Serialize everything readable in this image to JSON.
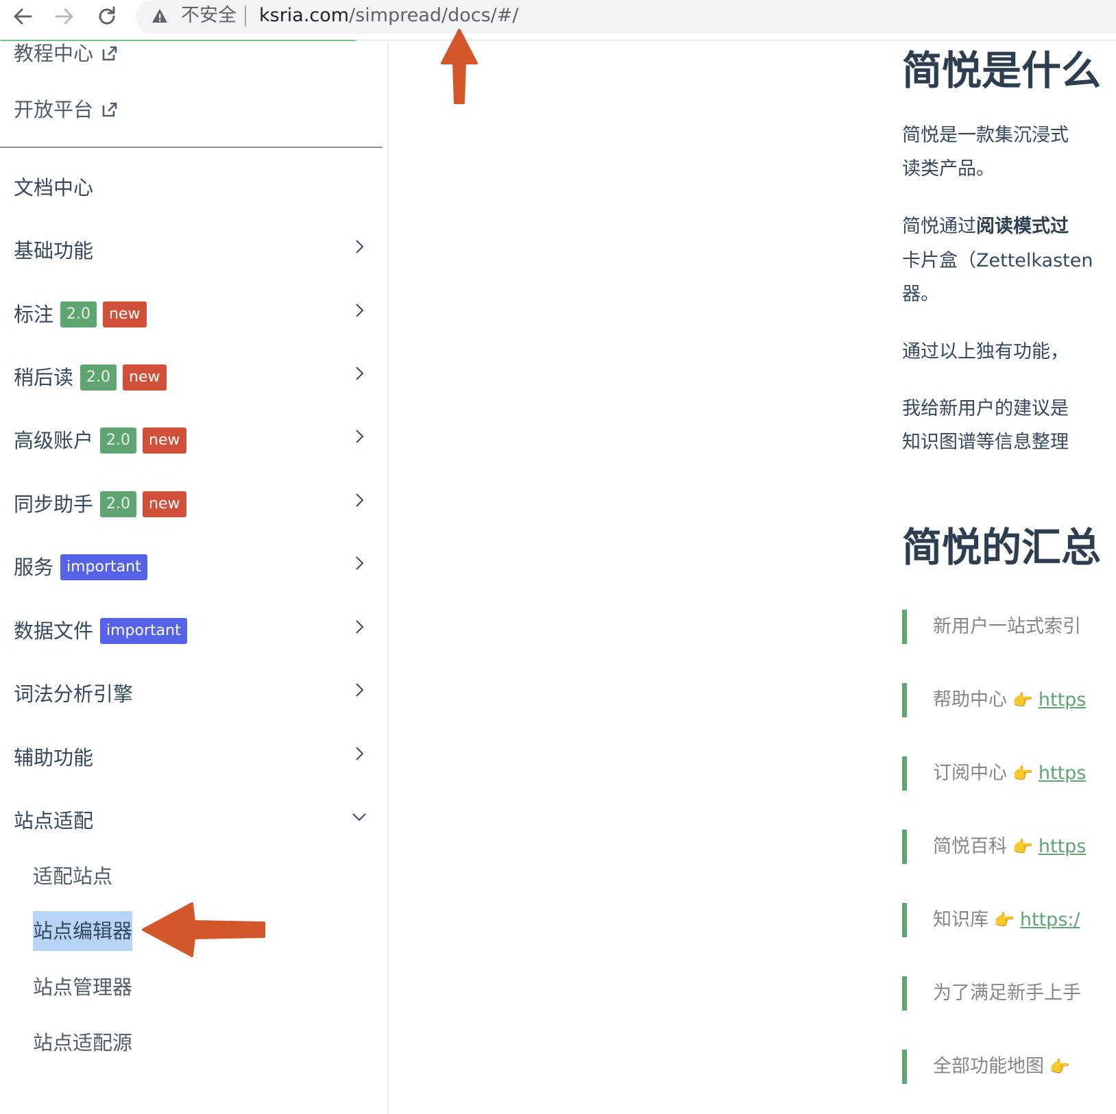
{
  "browser": {
    "security_label": "不安全",
    "url_host": "ksria.com",
    "url_path": "/simpread/docs/#/"
  },
  "sidebar": {
    "external_links": [
      {
        "label": "教程中心"
      },
      {
        "label": "开放平台"
      }
    ],
    "section_title": "文档中心",
    "items": [
      {
        "label": "基础功能",
        "badges": []
      },
      {
        "label": "标注",
        "badges": [
          {
            "text": "2.0",
            "color": "green"
          },
          {
            "text": "new",
            "color": "red"
          }
        ]
      },
      {
        "label": "稍后读",
        "badges": [
          {
            "text": "2.0",
            "color": "green"
          },
          {
            "text": "new",
            "color": "red"
          }
        ]
      },
      {
        "label": "高级账户",
        "badges": [
          {
            "text": "2.0",
            "color": "green"
          },
          {
            "text": "new",
            "color": "red"
          }
        ]
      },
      {
        "label": "同步助手",
        "badges": [
          {
            "text": "2.0",
            "color": "green"
          },
          {
            "text": "new",
            "color": "red"
          }
        ]
      },
      {
        "label": "服务",
        "badges": [
          {
            "text": "important",
            "color": "blue"
          }
        ]
      },
      {
        "label": "数据文件",
        "badges": [
          {
            "text": "important",
            "color": "blue"
          }
        ]
      },
      {
        "label": "词法分析引擎",
        "badges": []
      },
      {
        "label": "辅助功能",
        "badges": []
      },
      {
        "label": "站点适配",
        "badges": [],
        "expanded": true
      }
    ],
    "sub_items": [
      {
        "label": "适配站点"
      },
      {
        "label": "站点编辑器",
        "active": true
      },
      {
        "label": "站点管理器"
      },
      {
        "label": "站点适配源"
      }
    ]
  },
  "content": {
    "heading1": "简悦是什么",
    "p1_line1": "简悦是一款集沉浸式",
    "p1_line2": "读类产品。",
    "p2_prefix": "简悦通过",
    "p2_bold": "阅读模式过",
    "p2_line2": "卡片盒（Zettelkasten",
    "p2_line3": "器。",
    "p3": "通过以上独有功能，",
    "p4_line1": "我给新用户的建议是",
    "p4_line2": "知识图谱等信息整理",
    "heading2": "简悦的汇总",
    "quotes": [
      {
        "text": "新用户一站式索引",
        "link": ""
      },
      {
        "text": "帮助中心",
        "link": "https"
      },
      {
        "text": "订阅中心",
        "link": "https"
      },
      {
        "text": "简悦百科",
        "link": "https"
      },
      {
        "text": "知识库",
        "link": "https:/"
      },
      {
        "text": "为了满足新手上手",
        "link": ""
      },
      {
        "text": "全部功能地图",
        "link": ""
      }
    ]
  },
  "colors": {
    "accent_green": "#5ea572",
    "badge_red": "#d2503a",
    "badge_blue": "#5663e8",
    "annotation_arrow": "#d4572b",
    "active_highlight": "#b9d4f6"
  }
}
